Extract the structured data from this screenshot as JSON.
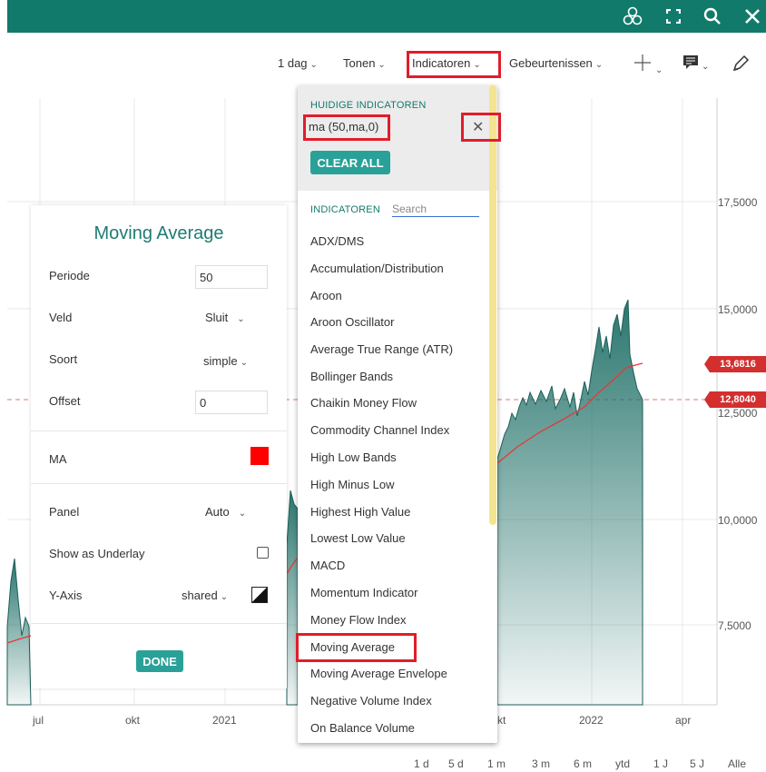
{
  "topbar": {
    "icons": [
      "compare-icon",
      "fullscreen-icon",
      "search-icon",
      "close-icon"
    ],
    "color": "#127a6b"
  },
  "toolbar": {
    "period": "1 dag",
    "tonen": "Tonen",
    "indicatoren": "Indicatoren",
    "gebeurtenissen": "Gebeurtenissen"
  },
  "dropdown": {
    "current_header": "HUIDIGE INDICATOREN",
    "current_item": "ma (50,ma,0)",
    "remove": "✕",
    "clear_all": "CLEAR ALL",
    "indicators_header": "INDICATOREN",
    "search_placeholder": "Search",
    "items": [
      "ADX/DMS",
      "Accumulation/Distribution",
      "Aroon",
      "Aroon Oscillator",
      "Average True Range (ATR)",
      "Bollinger Bands",
      "Chaikin Money Flow",
      "Commodity Channel Index",
      "High Low Bands",
      "High Minus Low",
      "Highest High Value",
      "Lowest Low Value",
      "MACD",
      "Momentum Indicator",
      "Money Flow Index",
      "Moving Average",
      "Moving Average Envelope",
      "Negative Volume Index",
      "On Balance Volume"
    ]
  },
  "ma_panel": {
    "title": "Moving Average",
    "periode_label": "Periode",
    "periode_value": "50",
    "veld_label": "Veld",
    "veld_value": "Sluit",
    "soort_label": "Soort",
    "soort_value": "simple",
    "offset_label": "Offset",
    "offset_value": "0",
    "ma_label": "MA",
    "ma_color": "#ff0000",
    "panel_label": "Panel",
    "panel_value": "Auto",
    "underlay_label": "Show as Underlay",
    "yaxis_label": "Y-Axis",
    "yaxis_value": "shared",
    "done": "DONE"
  },
  "chart": {
    "y_labels": [
      "17,5000",
      "15,0000",
      "12,5000",
      "10,0000",
      "7,5000"
    ],
    "x_labels": [
      "jul",
      "okt",
      "2021",
      "kt",
      "2022",
      "apr"
    ],
    "price_tags": [
      "13,6816",
      "12,8040"
    ],
    "ranges": [
      "1 d",
      "5 d",
      "1 m",
      "3 m",
      "6 m",
      "ytd",
      "1 J",
      "5 J",
      "Alle"
    ],
    "area_color": "#1f6f67",
    "ma_line_color": "#e53935"
  }
}
